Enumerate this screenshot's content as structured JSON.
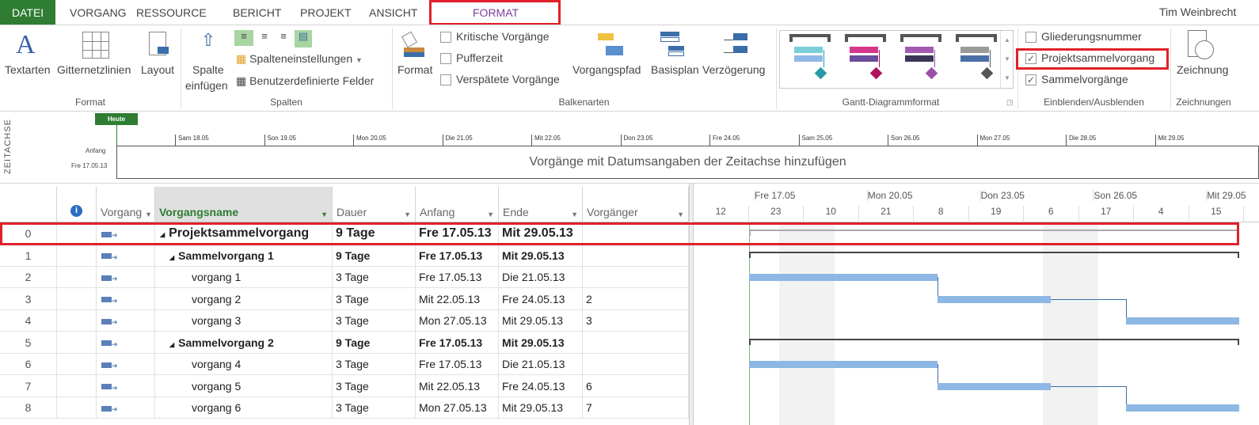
{
  "tabs": [
    {
      "label": "DATEI"
    },
    {
      "label": "VORGANG"
    },
    {
      "label": "RESSOURCE"
    },
    {
      "label": "BERICHT"
    },
    {
      "label": "PROJEKT"
    },
    {
      "label": "ANSICHT"
    },
    {
      "label": "FORMAT"
    }
  ],
  "user": "Tim Weinbrecht",
  "ribbon": {
    "format_group": {
      "label": "Format",
      "textarten": "Textarten",
      "gitternetzlinien": "Gitternetzlinien",
      "layout": "Layout"
    },
    "spalten_group": {
      "label": "Spalten",
      "spalte_einfuegen_1": "Spalte",
      "spalte_einfuegen_2": "einfügen",
      "spalteneinstellungen": "Spalteneinstellungen",
      "benutzerdefinierte": "Benutzerdefinierte Felder"
    },
    "balkenarten_group": {
      "label": "Balkenarten",
      "format": "Format",
      "kritische": "Kritische Vorgänge",
      "pufferzeit": "Pufferzeit",
      "verspaetete": "Verspätete Vorgänge",
      "vorgangspfad": "Vorgangspfad",
      "basisplan": "Basisplan",
      "verzoegerung": "Verzögerung"
    },
    "gantt_group": {
      "label": "Gantt-Diagrammformat",
      "styles": [
        {
          "top": "#7ccfd8",
          "bottom": "#8fb8e8",
          "accent": "#2a9aa8"
        },
        {
          "top": "#d4388a",
          "bottom": "#6a4c9c",
          "accent": "#b0125f"
        },
        {
          "top": "#a35ab0",
          "bottom": "#3b3558",
          "accent": "#9a50a8"
        },
        {
          "top": "#9a9a9a",
          "bottom": "#4a6fa8",
          "accent": "#555555"
        }
      ]
    },
    "einblenden_group": {
      "label": "Einblenden/Ausblenden",
      "gliederungsnummer": {
        "label": "Gliederungsnummer",
        "checked": false
      },
      "projektsammelvorgang": {
        "label": "Projektsammelvorgang",
        "checked": true
      },
      "sammelvorgaenge": {
        "label": "Sammelvorgänge",
        "checked": true
      }
    },
    "zeichnungen_group": {
      "label": "Zeichnungen",
      "zeichnung": "Zeichnung"
    }
  },
  "timeline": {
    "side_label": "ZEITACHSE",
    "today": "Heute",
    "start_label": "Anfang",
    "start_date": "Fre 17.05.13",
    "placeholder": "Vorgänge mit Datumsangaben der Zeitachse hinzufügen",
    "ticks": [
      "Sam 18.05",
      "Son 19.05",
      "Mon 20.05",
      "Die 21.05",
      "Mit 22.05",
      "Don 23.05",
      "Fre 24.05",
      "Sam 25.05",
      "Son 26.05",
      "Mon 27.05",
      "Die 28.05",
      "Mit 29.05"
    ]
  },
  "table": {
    "headers": {
      "mode": "Vorgang",
      "name": "Vorgangsname",
      "dauer": "Dauer",
      "anfang": "Anfang",
      "ende": "Ende",
      "vorgaenger": "Vorgänger"
    },
    "rows": [
      {
        "id": "0",
        "name": "Projektsammelvorgang",
        "dauer": "9 Tage",
        "anfang": "Fre 17.05.13",
        "ende": "Mit 29.05.13",
        "vorg": "",
        "level": 0,
        "summary": true,
        "project": true
      },
      {
        "id": "1",
        "name": "Sammelvorgang 1",
        "dauer": "9 Tage",
        "anfang": "Fre 17.05.13",
        "ende": "Mit 29.05.13",
        "vorg": "",
        "level": 1,
        "summary": true
      },
      {
        "id": "2",
        "name": "vorgang 1",
        "dauer": "3 Tage",
        "anfang": "Fre 17.05.13",
        "ende": "Die 21.05.13",
        "vorg": "",
        "level": 2
      },
      {
        "id": "3",
        "name": "vorgang 2",
        "dauer": "3 Tage",
        "anfang": "Mit 22.05.13",
        "ende": "Fre 24.05.13",
        "vorg": "2",
        "level": 2
      },
      {
        "id": "4",
        "name": "vorgang 3",
        "dauer": "3 Tage",
        "anfang": "Mon 27.05.13",
        "ende": "Mit 29.05.13",
        "vorg": "3",
        "level": 2
      },
      {
        "id": "5",
        "name": "Sammelvorgang 2",
        "dauer": "9 Tage",
        "anfang": "Fre 17.05.13",
        "ende": "Mit 29.05.13",
        "vorg": "",
        "level": 1,
        "summary": true
      },
      {
        "id": "6",
        "name": "vorgang 4",
        "dauer": "3 Tage",
        "anfang": "Fre 17.05.13",
        "ende": "Die 21.05.13",
        "vorg": "",
        "level": 2
      },
      {
        "id": "7",
        "name": "vorgang 5",
        "dauer": "3 Tage",
        "anfang": "Mit 22.05.13",
        "ende": "Fre 24.05.13",
        "vorg": "6",
        "level": 2
      },
      {
        "id": "8",
        "name": "vorgang 6",
        "dauer": "3 Tage",
        "anfang": "Mon 27.05.13",
        "ende": "Mit 29.05.13",
        "vorg": "7",
        "level": 2
      }
    ]
  },
  "gantt": {
    "top_scale": [
      "Fre 17.05",
      "Mon 20.05",
      "Don 23.05",
      "Son 26.05",
      "Mit 29.05"
    ],
    "bottom_scale": [
      "12",
      "23",
      "10",
      "21",
      "8",
      "19",
      "6",
      "17",
      "4",
      "15"
    ],
    "bar_color": "#8db7e4",
    "highlight_color": "#e0202a"
  }
}
